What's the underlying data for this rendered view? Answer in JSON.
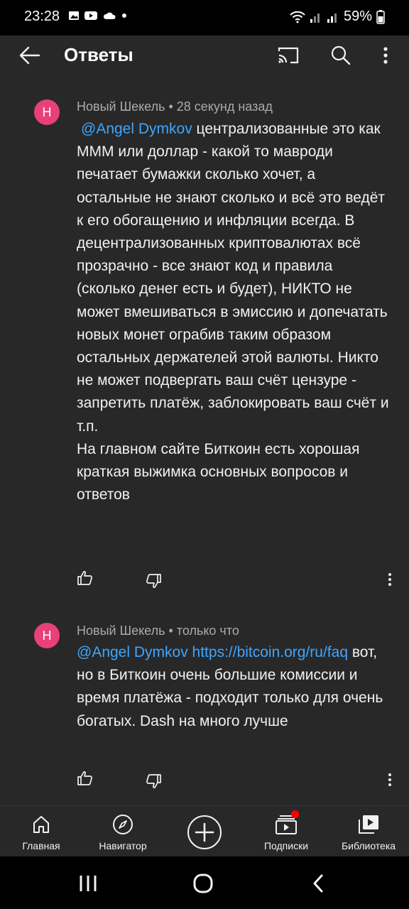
{
  "status_bar": {
    "time": "23:28",
    "battery": "59%",
    "icons_left": [
      "gallery-icon",
      "youtube-icon",
      "cloud-icon",
      "dot-icon"
    ],
    "icons_right": [
      "wifi-icon",
      "signal-icon",
      "signal-icon",
      "battery-icon"
    ]
  },
  "app_bar": {
    "title": "Ответы",
    "icons": [
      "back-arrow-icon",
      "cast-icon",
      "search-icon",
      "more-vert-icon"
    ]
  },
  "comments": [
    {
      "avatar_letter": "Н",
      "author": "Новый Шекель",
      "time": "28 секунд назад",
      "mention": "@Angel Dymkov",
      "text": "централизованные это как МММ или доллар - какой то мавроди печатает бумажки сколько хочет, а остальные не знают сколько и всё это ведёт к его обогащению и инфляции всегда. В децентрализованных криптовалютах всё прозрачно - все знают код и правила (сколько денег есть и будет), НИКТО не может вмешиваться в эмиссию и допечатать новых монет ограбив таким образом остальных держателей этой валюты. Никто не может подвергать ваш счёт цензуре - запретить платёж, заблокировать ваш счёт и т.п.",
      "text2": "На главном сайте Биткоин есть хорошая краткая выжимка основных вопросов и ответов"
    },
    {
      "avatar_letter": "Н",
      "author": "Новый Шекель",
      "time": "только что",
      "mention": "@Angel Dymkov",
      "link": "https://bitcoin.org/ru/faq",
      "text": "вот, но в Биткоин очень большие комиссии и время платёжа - подходит только для очень богатых. Dash на много лучше"
    }
  ],
  "bottom_nav": [
    {
      "label": "Главная",
      "icon": "home-icon"
    },
    {
      "label": "Навигатор",
      "icon": "compass-icon"
    },
    {
      "label": "",
      "icon": "create-plus-icon"
    },
    {
      "label": "Подписки",
      "icon": "subscriptions-icon"
    },
    {
      "label": "Библиотека",
      "icon": "library-icon"
    }
  ],
  "colors": {
    "background": "#282828",
    "accent_link": "#3ea6ff",
    "avatar": "#e8407a",
    "badge": "#ff0000"
  }
}
